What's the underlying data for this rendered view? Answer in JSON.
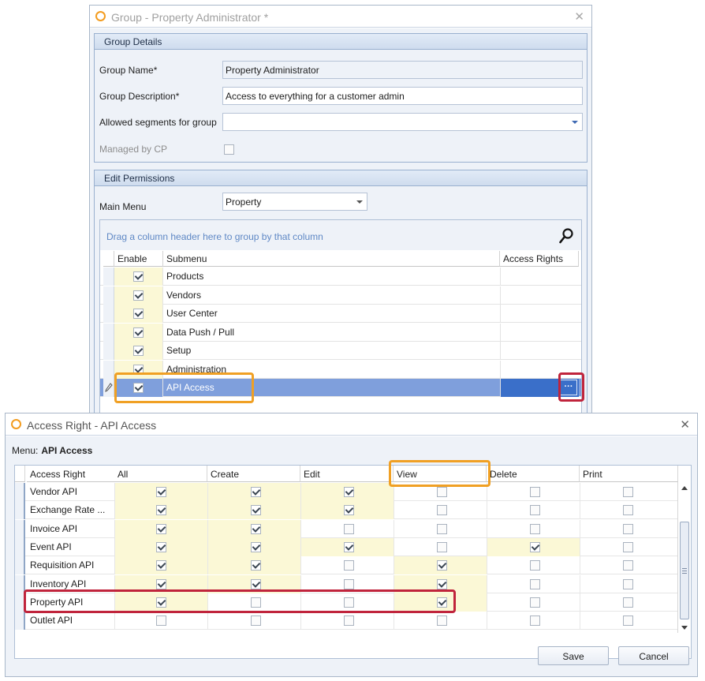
{
  "group_window": {
    "title": "Group - Property Administrator *",
    "close_glyph": "✕",
    "group_details": {
      "header": "Group Details",
      "group_name_label": "Group Name*",
      "group_name_value": "Property Administrator",
      "group_description_label": "Group Description*",
      "group_description_value": "Access to everything for a customer admin",
      "allowed_segments_label": "Allowed segments for group",
      "allowed_segments_value": "",
      "managed_by_cp_label": "Managed by CP",
      "managed_by_cp_checked": false
    },
    "edit_permissions": {
      "header": "Edit Permissions",
      "main_menu_label": "Main Menu",
      "main_menu_value": "Property",
      "grid": {
        "group_panel_text": "Drag a column header here to group by that column",
        "columns": [
          "Enable",
          "Submenu",
          "Access Rights"
        ],
        "rows": [
          {
            "enable": true,
            "submenu": "Products",
            "selected": false
          },
          {
            "enable": true,
            "submenu": "Vendors",
            "selected": false
          },
          {
            "enable": true,
            "submenu": "User Center",
            "selected": false
          },
          {
            "enable": true,
            "submenu": "Data Push / Pull",
            "selected": false
          },
          {
            "enable": true,
            "submenu": "Setup",
            "selected": false
          },
          {
            "enable": true,
            "submenu": "Administration",
            "selected": false
          },
          {
            "enable": true,
            "submenu": "API Access",
            "selected": true
          }
        ],
        "ellipsis_label": "···"
      }
    }
  },
  "access_window": {
    "title": "Access Right - API Access",
    "close_glyph": "✕",
    "menu_label": "Menu:",
    "menu_value": "API Access",
    "columns": [
      "Access Right",
      "All",
      "Create",
      "Edit",
      "View",
      "Delete",
      "Print"
    ],
    "rows": [
      {
        "name": "Vendor API",
        "all": true,
        "create": true,
        "edit": true,
        "view": false,
        "delete": false,
        "print": false
      },
      {
        "name": "Exchange Rate ...",
        "all": true,
        "create": true,
        "edit": true,
        "view": false,
        "delete": false,
        "print": false
      },
      {
        "name": "Invoice API",
        "all": true,
        "create": true,
        "edit": false,
        "view": false,
        "delete": false,
        "print": false
      },
      {
        "name": "Event API",
        "all": true,
        "create": true,
        "edit": true,
        "view": false,
        "delete": true,
        "print": false
      },
      {
        "name": "Requisition API",
        "all": true,
        "create": true,
        "edit": false,
        "view": true,
        "delete": false,
        "print": false
      },
      {
        "name": "Inventory API",
        "all": true,
        "create": true,
        "edit": false,
        "view": true,
        "delete": false,
        "print": false
      },
      {
        "name": "Property API",
        "all": true,
        "create": false,
        "edit": false,
        "view": true,
        "delete": false,
        "print": false
      },
      {
        "name": "Outlet API",
        "all": false,
        "create": false,
        "edit": false,
        "view": false,
        "delete": false,
        "print": false
      }
    ],
    "save_label": "Save",
    "cancel_label": "Cancel"
  },
  "colors": {
    "accent_orange": "#f0a024",
    "highlight_red": "#c0243c",
    "selection_blue": "#7f9fdc",
    "selection_blue_dark": "#3a6fc9",
    "checked_cell_yellow": "#fbf8d6"
  },
  "icons": {
    "app": "orange-ring-icon",
    "close": "close-icon",
    "search": "search-icon",
    "dropdown": "chevron-down-icon",
    "edit_row": "pencil-icon",
    "ellipsis": "ellipsis-icon"
  }
}
